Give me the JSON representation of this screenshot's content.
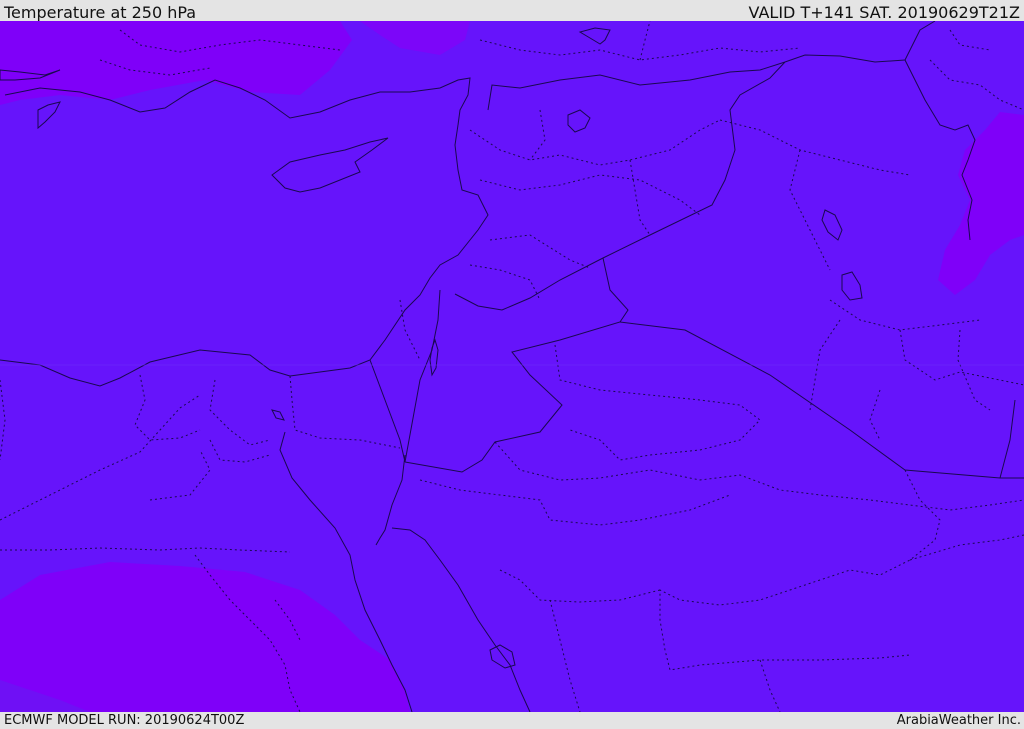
{
  "header": {
    "title": "Temperature at 250 hPa",
    "valid": "VALID T+141 SAT. 20190629T21Z"
  },
  "footer": {
    "model_run": "ECMWF MODEL RUN: 20190624T00Z",
    "credit": "ArabiaWeather Inc."
  },
  "colors": {
    "main_field": "#6614fb",
    "warm_field": "#7f00f9",
    "coast_line": "#1a0850",
    "border_line": "#1a0850",
    "bar_background": "#e4e4e4"
  }
}
